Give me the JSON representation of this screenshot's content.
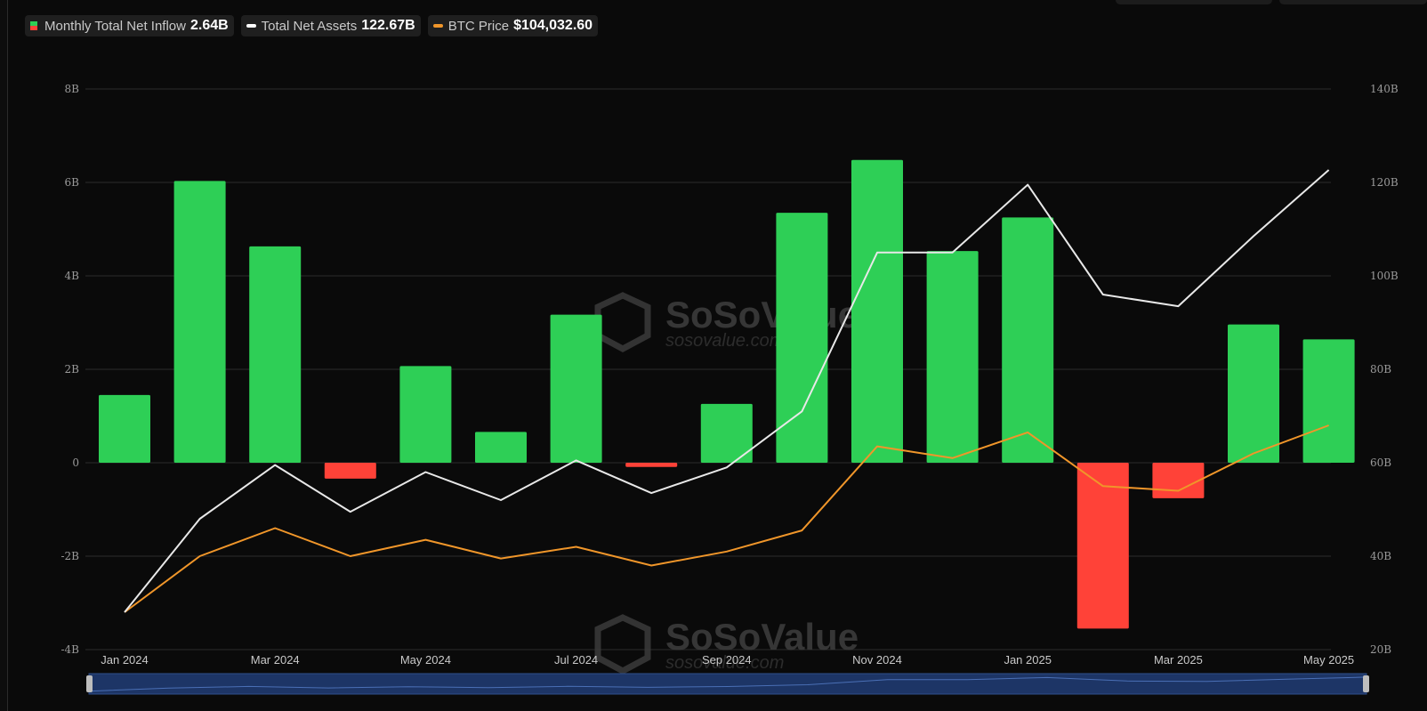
{
  "legend": {
    "items": [
      {
        "label": "Monthly Total Net Inflow",
        "value": "2.64B"
      },
      {
        "label": "Total Net Assets",
        "value": "122.67B"
      },
      {
        "label": "BTC Price",
        "value": "$104,032.60"
      }
    ]
  },
  "watermark": {
    "brand": "SoSoValue",
    "url": "sosovalue.com"
  },
  "colors": {
    "background": "#0a0a0a",
    "positive": "#2ecf56",
    "negative": "#ff4238",
    "assets_line": "#e8e8e8",
    "btc_line": "#f0962a",
    "grid": "#2c2c2c",
    "axis_text": "#9a9a9a",
    "navigator_fill": "#1d3566"
  },
  "chart_data": {
    "type": "bar",
    "title": "",
    "xlabel": "",
    "ylabel": "",
    "categories": [
      "Jan 2024",
      "Feb 2024",
      "Mar 2024",
      "Apr 2024",
      "May 2024",
      "Jun 2024",
      "Jul 2024",
      "Aug 2024",
      "Sep 2024",
      "Oct 2024",
      "Nov 2024",
      "Dec 2024",
      "Jan 2025",
      "Feb 2025",
      "Mar 2025",
      "Apr 2025",
      "May 2025"
    ],
    "x_tick_labels": [
      "Jan 2024",
      "Mar 2024",
      "May 2024",
      "Jul 2024",
      "Sep 2024",
      "Nov 2024",
      "Jan 2025",
      "Mar 2025",
      "May 2025"
    ],
    "y_left": {
      "ticks": [
        "8B",
        "6B",
        "4B",
        "2B",
        "0",
        "-2B",
        "-4B"
      ],
      "ylim": [
        -4,
        8
      ],
      "unit": "B"
    },
    "y_right": {
      "ticks": [
        "140B",
        "120B",
        "100B",
        "80B",
        "60B",
        "40B",
        "20B"
      ],
      "ylim": [
        20,
        140
      ],
      "unit": "B"
    },
    "grid": true,
    "legend_position": "top-left",
    "series": [
      {
        "name": "Monthly Total Net Inflow",
        "kind": "bar",
        "axis": "left",
        "values": [
          1.45,
          6.03,
          4.63,
          -0.34,
          2.07,
          0.66,
          3.17,
          -0.09,
          1.26,
          5.35,
          6.48,
          4.53,
          5.25,
          -3.55,
          -0.76,
          2.96,
          2.64
        ]
      },
      {
        "name": "Total Net Assets",
        "kind": "line",
        "axis": "right",
        "values": [
          28,
          48,
          59.5,
          49.5,
          58,
          52,
          60.5,
          53.5,
          59,
          71,
          105,
          105,
          119.5,
          96,
          93.5,
          108.5,
          122.67
        ]
      },
      {
        "name": "BTC Price",
        "kind": "line",
        "axis": "right",
        "values": [
          28,
          40,
          46,
          40,
          43.5,
          39.5,
          42,
          38,
          41,
          45.5,
          63.5,
          61,
          66.5,
          55,
          54,
          62,
          68
        ]
      }
    ]
  }
}
